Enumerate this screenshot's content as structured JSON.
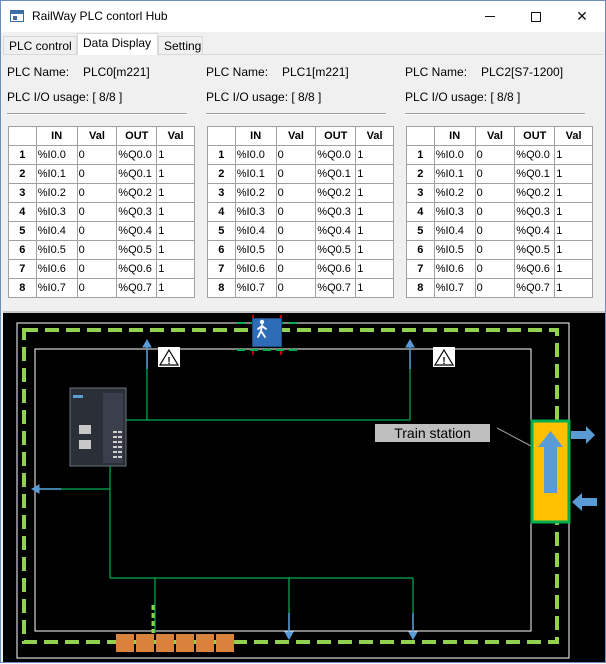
{
  "window": {
    "title": "RailWay PLC contorl Hub",
    "minimize_glyph": "",
    "maximize_glyph": "",
    "close_glyph": "✕"
  },
  "tabs": [
    {
      "label": "PLC control",
      "active": false
    },
    {
      "label": "Data Display",
      "active": true
    },
    {
      "label": "Setting",
      "active": false
    }
  ],
  "plcs": [
    {
      "name_label": "PLC Name:",
      "name_value": "PLC0[m221]",
      "io_usage": "PLC I/O usage:  [ 8/8 ]",
      "headers": [
        "",
        "IN",
        "Val",
        "OUT",
        "Val"
      ],
      "rows": [
        [
          "1",
          "%I0.0",
          "0",
          "%Q0.0",
          "1"
        ],
        [
          "2",
          "%I0.1",
          "0",
          "%Q0.1",
          "1"
        ],
        [
          "3",
          "%I0.2",
          "0",
          "%Q0.2",
          "1"
        ],
        [
          "4",
          "%I0.3",
          "0",
          "%Q0.3",
          "1"
        ],
        [
          "5",
          "%I0.4",
          "0",
          "%Q0.4",
          "1"
        ],
        [
          "6",
          "%I0.5",
          "0",
          "%Q0.5",
          "1"
        ],
        [
          "7",
          "%I0.6",
          "0",
          "%Q0.6",
          "1"
        ],
        [
          "8",
          "%I0.7",
          "0",
          "%Q0.7",
          "1"
        ]
      ]
    },
    {
      "name_label": "PLC Name:",
      "name_value": "PLC1[m221]",
      "io_usage": "PLC I/O usage:  [ 8/8 ]",
      "headers": [
        "",
        "IN",
        "Val",
        "OUT",
        "Val"
      ],
      "rows": [
        [
          "1",
          "%I0.0",
          "0",
          "%Q0.0",
          "1"
        ],
        [
          "2",
          "%I0.1",
          "0",
          "%Q0.1",
          "1"
        ],
        [
          "3",
          "%I0.2",
          "0",
          "%Q0.2",
          "1"
        ],
        [
          "4",
          "%I0.3",
          "0",
          "%Q0.3",
          "1"
        ],
        [
          "5",
          "%I0.4",
          "0",
          "%Q0.4",
          "1"
        ],
        [
          "6",
          "%I0.5",
          "0",
          "%Q0.5",
          "1"
        ],
        [
          "7",
          "%I0.6",
          "0",
          "%Q0.6",
          "1"
        ],
        [
          "8",
          "%I0.7",
          "0",
          "%Q0.7",
          "1"
        ]
      ]
    },
    {
      "name_label": "PLC Name:",
      "name_value": "PLC2[S7-1200]",
      "io_usage": "PLC I/O usage:  [ 8/8 ]",
      "headers": [
        "",
        "IN",
        "Val",
        "OUT",
        "Val"
      ],
      "rows": [
        [
          "1",
          "%I0.0",
          "0",
          "%Q0.0",
          "1"
        ],
        [
          "2",
          "%I0.1",
          "0",
          "%Q0.1",
          "1"
        ],
        [
          "3",
          "%I0.2",
          "0",
          "%Q0.2",
          "1"
        ],
        [
          "4",
          "%I0.3",
          "0",
          "%Q0.3",
          "1"
        ],
        [
          "5",
          "%I0.4",
          "0",
          "%Q0.4",
          "1"
        ],
        [
          "6",
          "%I0.5",
          "0",
          "%Q0.5",
          "1"
        ],
        [
          "7",
          "%I0.6",
          "0",
          "%Q0.6",
          "1"
        ],
        [
          "8",
          "%I0.7",
          "0",
          "%Q0.7",
          "1"
        ]
      ]
    }
  ],
  "railway": {
    "station_label": "Train station",
    "warning_glyph": "!",
    "colors": {
      "background": "#000000",
      "track_dash": "#92d050",
      "wire": "#00b050",
      "sensor_arrow": "#5b9bd5",
      "station_fill": "#ffc000",
      "station_border": "#00b050",
      "crossing_block": "#d9823b",
      "ped_button": "#2e6cb7"
    },
    "icons": [
      "plc-device-icon",
      "warning-sign-icon",
      "pedestrian-icon",
      "train-icon",
      "arrow-right-icon",
      "arrow-left-icon"
    ]
  }
}
